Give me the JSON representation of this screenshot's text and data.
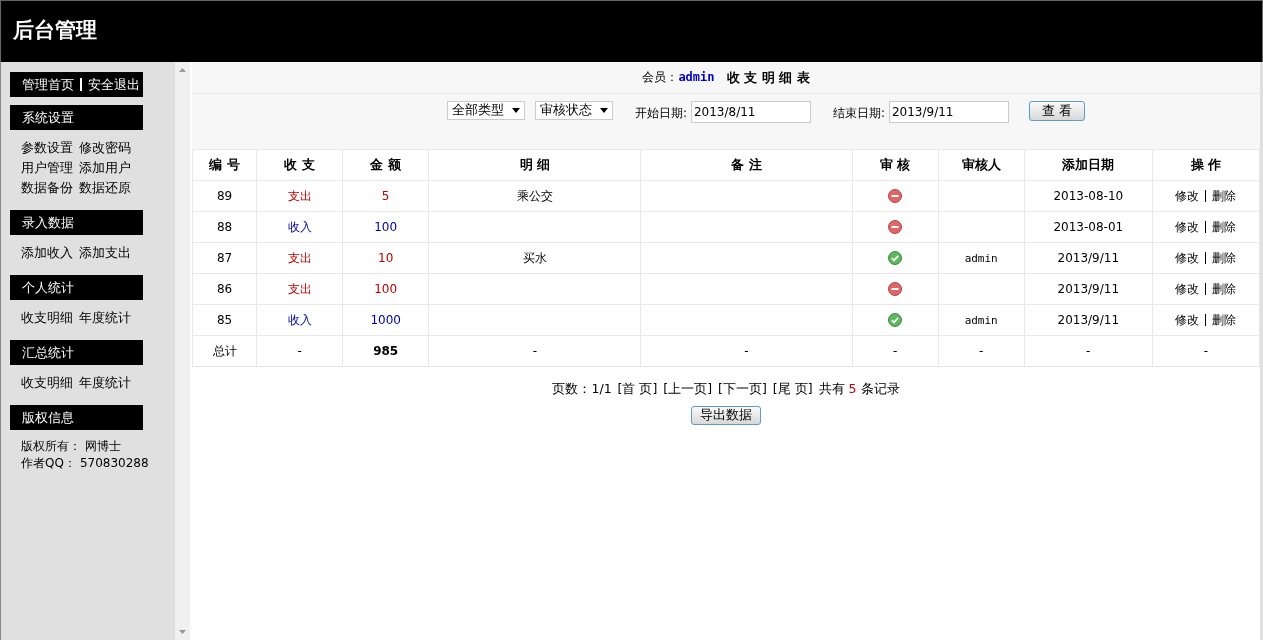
{
  "header": {
    "title": "后台管理"
  },
  "sidebar": {
    "top_links": [
      "管理首页",
      "安全退出"
    ],
    "sections": [
      {
        "title": "系统设置",
        "links": [
          [
            "参数设置",
            "修改密码"
          ],
          [
            "用户管理",
            "添加用户"
          ],
          [
            "数据备份",
            "数据还原"
          ]
        ]
      },
      {
        "title": "录入数据",
        "links": [
          [
            "添加收入",
            "添加支出"
          ]
        ]
      },
      {
        "title": "个人统计",
        "links": [
          [
            "收支明细",
            "年度统计"
          ]
        ]
      },
      {
        "title": "汇总统计",
        "links": [
          [
            "收支明细",
            "年度统计"
          ]
        ]
      },
      {
        "title": "版权信息",
        "info": [
          {
            "label": "版权所有：",
            "value": "网博士"
          },
          {
            "label": "作者QQ：",
            "value": "570830288"
          }
        ]
      }
    ]
  },
  "report": {
    "member_label": "会员：",
    "member": "admin",
    "title": "收 支 明 细 表",
    "filters": {
      "type_select": "全部类型",
      "status_select": "审核状态",
      "start_label": "开始日期:",
      "start_value": "2013/8/11",
      "end_label": "结束日期:",
      "end_value": "2013/9/11",
      "view_button": "查 看"
    },
    "table": {
      "columns": [
        "编 号",
        "收 支",
        "金 额",
        "明 细",
        "备 注",
        "审 核",
        "审核人",
        "添加日期",
        "操 作"
      ],
      "rows": [
        {
          "kind": "entry",
          "id": "89",
          "type": "支出",
          "income": false,
          "amount": "5",
          "detail": "乘公交",
          "approved": false,
          "date": "2013-08-10",
          "edit": "修改",
          "delete": "删除"
        },
        {
          "kind": "entry",
          "id": "88",
          "type": "收入",
          "income": true,
          "amount": "100",
          "approved": false,
          "date": "2013-08-01",
          "edit": "修改",
          "delete": "删除"
        },
        {
          "kind": "entry",
          "id": "87",
          "type": "支出",
          "income": false,
          "amount": "10",
          "detail": "买水",
          "approved": true,
          "auditor": "admin",
          "date": "2013/9/11",
          "edit": "修改",
          "delete": "删除"
        },
        {
          "kind": "entry",
          "id": "86",
          "type": "支出",
          "income": false,
          "amount": "100",
          "approved": false,
          "date": "2013/9/11",
          "edit": "修改",
          "delete": "删除"
        },
        {
          "kind": "entry",
          "id": "85",
          "type": "收入",
          "income": true,
          "amount": "1000",
          "approved": true,
          "auditor": "admin",
          "date": "2013/9/11",
          "edit": "修改",
          "delete": "删除"
        },
        {
          "kind": "total",
          "cells": [
            "总计",
            "-",
            "985",
            "-",
            "-",
            "-",
            "-",
            "-",
            "-"
          ]
        }
      ]
    },
    "pager": {
      "pages_label": "页数：1/1",
      "links": [
        "[首 页]",
        "[上一页]",
        "[下一页]",
        "[尾 页]"
      ],
      "count_before": "共有",
      "count": "5",
      "count_after": "条记录"
    },
    "export_button": "导出数据"
  }
}
